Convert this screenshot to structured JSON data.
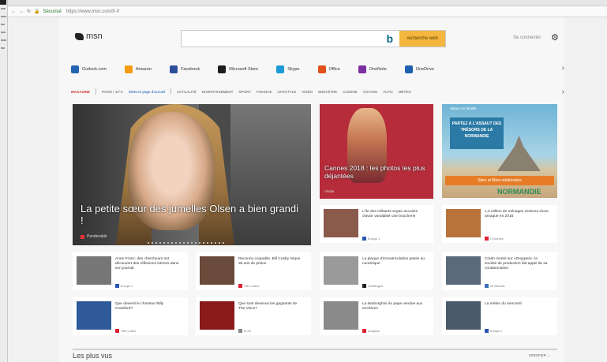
{
  "browser": {
    "security_label": "Sécurisé",
    "url": "https://www.msn.com/fr-fr"
  },
  "header": {
    "logo_text": "msn",
    "search_button": "recherche web",
    "signin": "Se connecter"
  },
  "quicklinks": [
    {
      "label": "Outlook.com",
      "color": "#2364b0"
    },
    {
      "label": "Amazon",
      "color": "#f39c12"
    },
    {
      "label": "Facebook",
      "color": "#2d4f9a"
    },
    {
      "label": "Microsoft Store",
      "color": "#1d1d1d"
    },
    {
      "label": "Skype",
      "color": "#1c9ad6"
    },
    {
      "label": "Office",
      "color": "#e0521d"
    },
    {
      "label": "OneNote",
      "color": "#7b2fa0"
    },
    {
      "label": "OneDrive",
      "color": "#1f5fb0"
    }
  ],
  "nav": {
    "active": "MAGAZINE",
    "weather": "PARIS / 10°C",
    "msn_home": "MSN en page d'accueil",
    "items": [
      "ACTUALITÉ",
      "DIVERTISSEMENT",
      "SPORT",
      "FINANCE",
      "LIFESTYLE",
      "VIDÉO",
      "BIEN-ÊTRE",
      "CUISINE",
      "VOYAGE",
      "AUTO",
      "MÉTÉO"
    ]
  },
  "hero": {
    "title": "La petite sœur des jumelles Olsen a bien grandi !",
    "source": "Ponderable"
  },
  "cannes": {
    "title": "Cannes 2018 : les photos les plus déjantées",
    "source": "Vivala"
  },
  "ad": {
    "tag": "Séjour en famille",
    "headline": "PARTEZ À L'ASSAUT DES TRÉSORS DE LA NORMANDIE",
    "cta": "Sites et fêtes médiévales",
    "brand": "NORMANDIE"
  },
  "cards": [
    {
      "text": "L'île des militants vegan accusés d'avoir vandalisé une boucherie",
      "source": "Europe 1",
      "src_color": "#2a56b0",
      "thumb": "#8a5a4a"
    },
    {
      "text": "1,2 million de ménages victimes d'une arnaque en 2016",
      "source": "L'Express",
      "src_color": "#d23",
      "thumb": "#b8733a"
    },
    {
      "text": "Anne Franc: des chercheurs ont découvert des réflexions intimes dans son journal",
      "source": "Europe 1",
      "src_color": "#2a56b0",
      "thumb": "#777"
    },
    {
      "text": "Reconnu coupable, Bill Cosby risque 30 ans de prison",
      "source": "Télé Loisirs",
      "src_color": "#d23",
      "thumb": "#6a4a3a"
    },
    {
      "text": "La plaque d'immatriculation passe au numérique",
      "source": "Challenges",
      "src_color": "#222",
      "thumb": "#9a9a9a"
    },
    {
      "text": "Crash mortel sur «Dropped»: la société de production fait appel de sa condamnation",
      "source": "20 Minutes",
      "src_color": "#3a72b8",
      "thumb": "#5a6a7a"
    },
    {
      "text": "Que devient le chanteur Billy Crawford?",
      "source": "Télé Loisirs",
      "src_color": "#d23",
      "thumb": "#2f5a9a"
    },
    {
      "text": "Que sont devenus les gagnants de The Voice?",
      "source": "ELLE",
      "src_color": "#888",
      "thumb": "#8a1a1a"
    },
    {
      "text": "La lamborghini du pape vendue aux enchères",
      "source": "Autoplus",
      "src_color": "#d23",
      "thumb": "#8a8a8a"
    },
    {
      "text": "La météo du mercredi",
      "source": "Europe 1",
      "src_color": "#2a56b0",
      "thumb": "#4a5a6a"
    }
  ],
  "footer": {
    "title": "Les plus vus",
    "modify": "MODIFIER ⌄"
  }
}
